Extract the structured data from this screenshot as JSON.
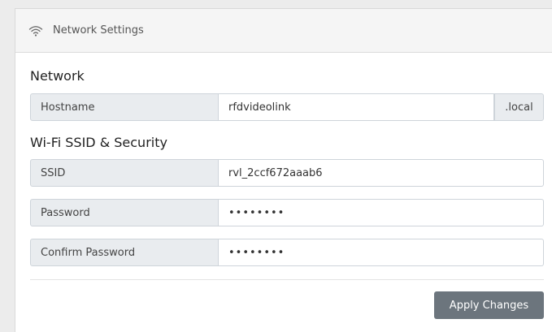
{
  "header": {
    "title": "Network Settings",
    "icon": "wifi-icon"
  },
  "network": {
    "section_title": "Network",
    "hostname_label": "Hostname",
    "hostname_value": "rfdvideolink",
    "hostname_suffix": ".local"
  },
  "wifi": {
    "section_title": "Wi-Fi SSID & Security",
    "ssid_label": "SSID",
    "ssid_value": "rvl_2ccf672aaab6",
    "password_label": "Password",
    "password_value": "••••••••",
    "confirm_label": "Confirm Password",
    "confirm_value": "••••••••"
  },
  "actions": {
    "apply_label": "Apply Changes"
  },
  "colors": {
    "button": "#6c757d",
    "addon_bg": "#e9ecef",
    "border": "#ced4da"
  }
}
